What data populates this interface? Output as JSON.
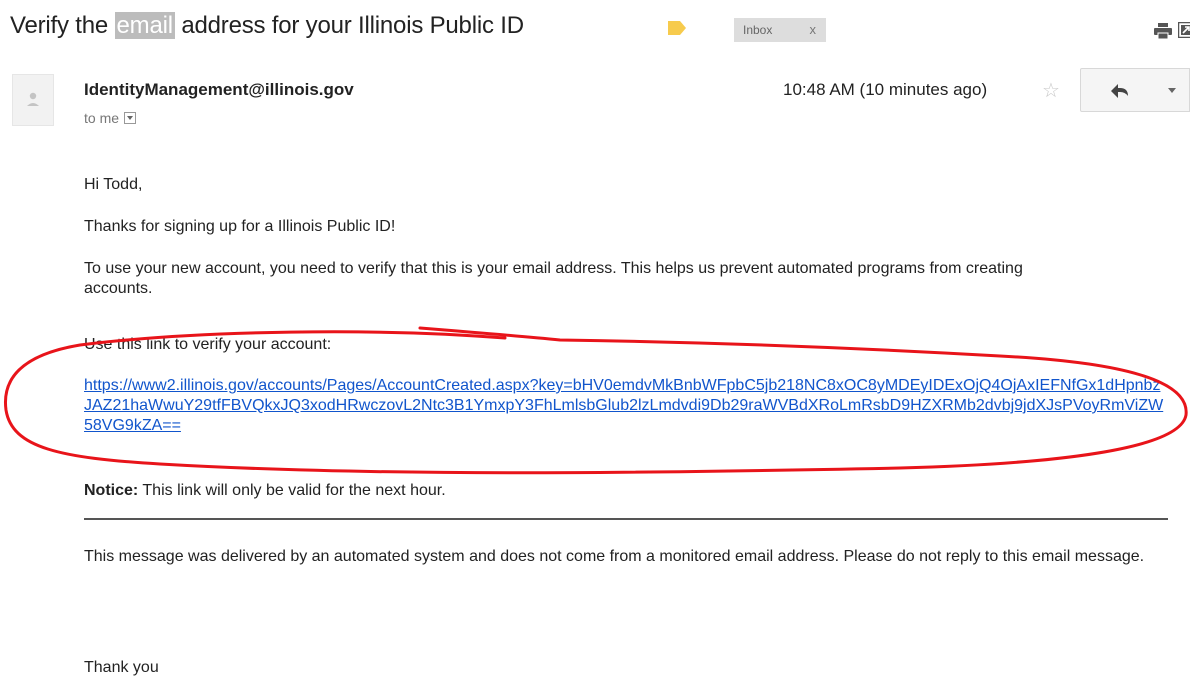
{
  "email": {
    "subject_before": "Verify the ",
    "subject_highlight": "email",
    "subject_after": " address for your Illinois Public ID",
    "label_chip": "Inbox",
    "label_chip_close": "x",
    "sender": "IdentityManagement@illinois.gov",
    "to": "to me",
    "timestamp": "10:48 AM (10 minutes ago)",
    "greeting": "Hi Todd,",
    "thanks": "Thanks for signing up for a Illinois Public ID!",
    "instructions": "To use your new account, you need to verify that this is your email address. This helps us prevent automated programs from creating accounts.",
    "link_intro": "Use this link to verify your account:",
    "verify_link": "https://www2.illinois.gov/accounts/Pages/AccountCreated.aspx?key=bHV0emdvMkBnbWFpbC5jb218NC8xOC8yMDEyIDExOjQ4OjAxIEFNfGx1dHpnbzJAZ21haWwuY29tfFBVQkxJQ3xodHRwczovL2Ntc3B1YmxpY3FhLmlsbGlub2lzLmdvdi9Db29raWVBdXRoLmRsbD9HZXRMb2dvbj9jdXJsPVoyRmViZW58VG9kZA==",
    "notice_label": "Notice:",
    "notice_text": " This link will only be valid for the next hour.",
    "automated_note": "This message was delivered by an automated system and does not come from a monitored email address. Please do not reply to this email message.",
    "closing": "Thank you"
  },
  "colors": {
    "link": "#1155cc",
    "label_tag": "#f7cb4d",
    "annotation_circle": "#e8141a"
  },
  "icons": [
    "label-tag-icon",
    "print-icon",
    "new-window-icon",
    "avatar-icon",
    "star-icon",
    "reply-icon",
    "more-dropdown-icon"
  ]
}
